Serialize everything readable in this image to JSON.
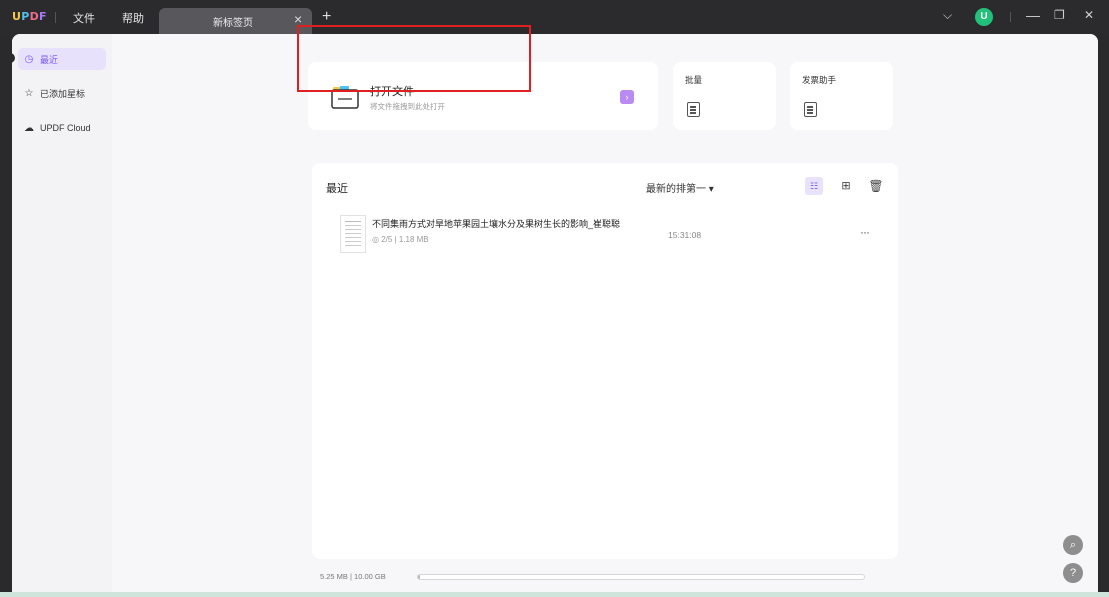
{
  "app": {
    "logo_letters": [
      "U",
      "P",
      "D",
      "F"
    ]
  },
  "menu": {
    "file": "文件",
    "help": "帮助"
  },
  "tab": {
    "label": "新标签页",
    "close": "×",
    "new": "+"
  },
  "window_controls": {
    "dropdown": "⌵",
    "avatar_initial": "U",
    "minimize": "—",
    "restore": "❐",
    "close": "✕"
  },
  "sidebar": {
    "items": [
      {
        "label": "最近",
        "icon": "clock-icon",
        "glyph": "◷",
        "active": true
      },
      {
        "label": "已添加星标",
        "icon": "star-icon",
        "glyph": "☆",
        "active": false
      },
      {
        "label": "UPDF Cloud",
        "icon": "cloud-icon",
        "glyph": "☁",
        "active": false
      }
    ]
  },
  "open_card": {
    "title": "打开文件",
    "subtitle": "将文件拖拽到此处打开",
    "arrow": "›"
  },
  "batch_card": {
    "title": "批量"
  },
  "invoice_card": {
    "title": "发票助手"
  },
  "recent": {
    "title": "最近",
    "sort_label": "最新的排第一 ▾",
    "view_list_icon": "☷",
    "view_grid_icon": "⊞",
    "trash_icon": "🗑",
    "files": [
      {
        "name": "不同集雨方式对旱地苹果园土壤水分及果树生长的影响_崔聪聪",
        "meta": "◎ 2/5  |  1.18 MB",
        "time": "15:31:08",
        "more": "···"
      }
    ]
  },
  "storage": {
    "text": "5.25 MB | 10.00 GB",
    "fraction_used": 0.0005
  },
  "floating": {
    "search": "⌕",
    "help": "?"
  },
  "colors": {
    "accent": "#7a5af5",
    "highlight": "#e02020",
    "avatar": "#22c17a"
  }
}
